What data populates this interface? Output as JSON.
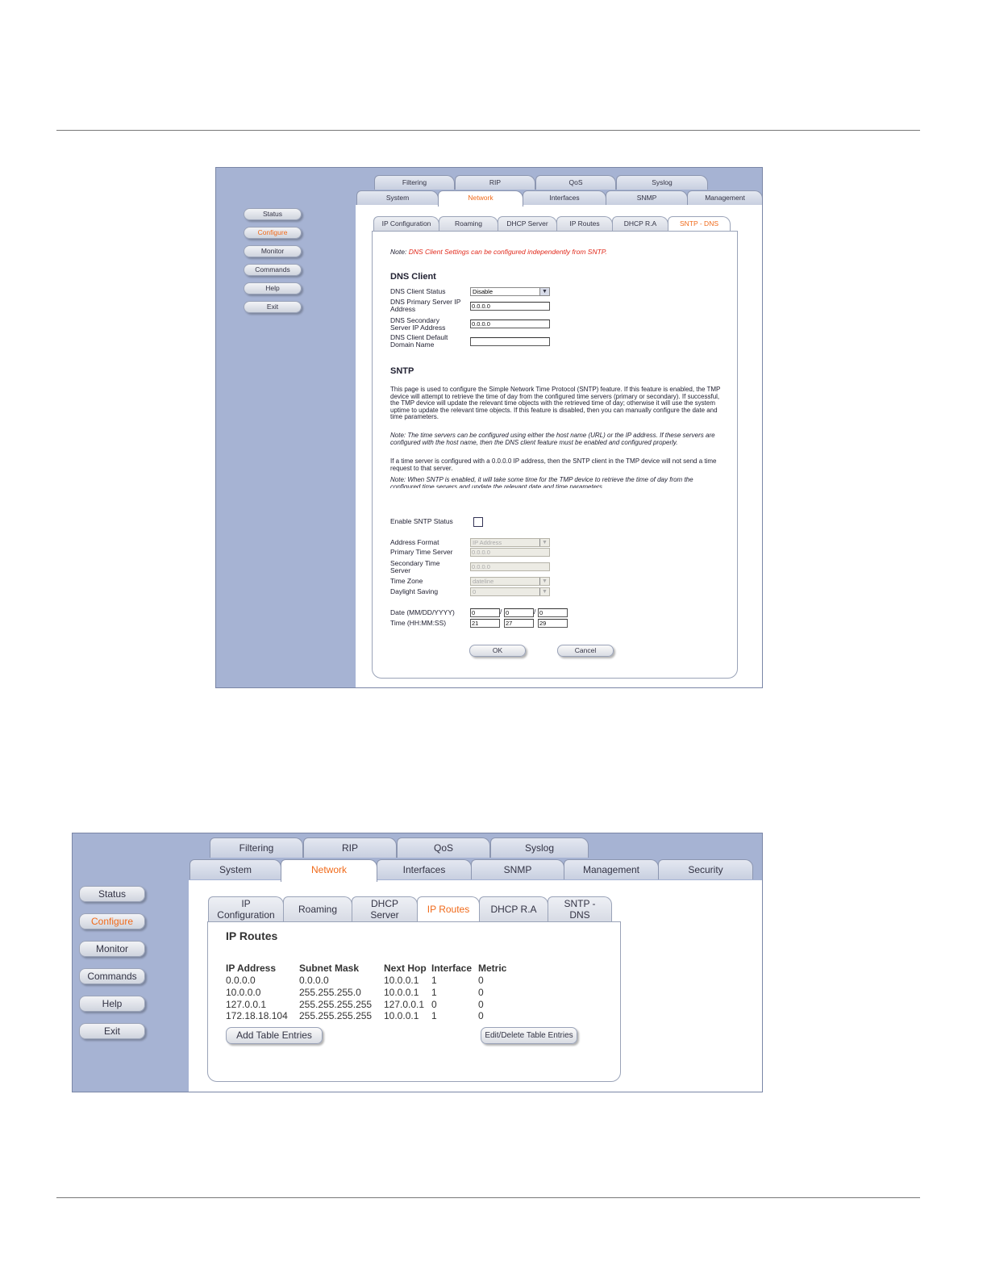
{
  "screenshot1": {
    "nav": [
      "Status",
      "Configure",
      "Monitor",
      "Commands",
      "Help",
      "Exit"
    ],
    "nav_active": "Configure",
    "tabs_row1": [
      "Filtering",
      "RIP",
      "QoS",
      "Syslog"
    ],
    "tabs_row2": [
      "System",
      "Network",
      "Interfaces",
      "SNMP",
      "Management"
    ],
    "subtabs": [
      "IP Configuration",
      "Roaming",
      "DHCP Server",
      "IP Routes",
      "DHCP R.A",
      "SNTP - DNS"
    ],
    "note_prefix": "Note:",
    "note_text": "DNS Client Settings can be configured independently from SNTP.",
    "dns_title": "DNS Client",
    "dns_status_label": "DNS Client Status",
    "dns_status_value": "Disable",
    "dns_primary_label_1": "DNS Primary Server IP",
    "dns_primary_label_2": "Address",
    "dns_primary_value": "0.0.0.0",
    "dns_secondary_label_1": "DNS Secondary",
    "dns_secondary_label_2": "Server IP Address",
    "dns_secondary_value": "0.0.0.0",
    "dns_domain_label_1": "DNS Client Default",
    "dns_domain_label_2": "Domain Name",
    "dns_domain_value": "",
    "sntp_title": "SNTP",
    "sntp_para1": "This page is used to configure the Simple Network Time Protocol (SNTP) feature. If this feature is enabled, the TMP device will attempt to retrieve the time of day from the configured time servers (primary or secondary). If successful, the TMP device will update the relevant time objects with the retrieved time of day; otherwise it will use the system uptime to update the relevant time objects. If this feature is disabled, then you can manually configure the date and time parameters.",
    "sntp_note1": "Note: The time servers can be configured using either the host name (URL) or the IP address. If these servers are configured with the host name, then the DNS client feature must be enabled and configured properly.",
    "sntp_para2": "If a time server is configured with a 0.0.0.0 IP address, then the SNTP client in the TMP device will not send a time request to that server.",
    "sntp_note2": "Note: When SNTP is enabled, it will take some time for the TMP device to retrieve the time of day from the configured time servers and update the relevant date and time parameters.",
    "enable_sntp_label": "Enable SNTP Status",
    "address_format_label": "Address Format",
    "address_format_value": "IP Address",
    "primary_time_label": "Primary Time Server",
    "primary_time_value": "0.0.0.0",
    "secondary_time_label_1": "Secondary Time",
    "secondary_time_label_2": "Server",
    "secondary_time_value": "0.0.0.0",
    "time_zone_label": "Time Zone",
    "time_zone_value": "dateline",
    "daylight_label": "Daylight Saving",
    "daylight_value": "0",
    "date_label": "Date (MM/DD/YYYY)",
    "date_values": [
      "0",
      "0",
      "0"
    ],
    "time_label": "Time (HH:MM:SS)",
    "time_values": [
      "21",
      "27",
      "29"
    ],
    "ok_label": "OK",
    "cancel_label": "Cancel"
  },
  "screenshot2": {
    "nav": [
      "Status",
      "Configure",
      "Monitor",
      "Commands",
      "Help",
      "Exit"
    ],
    "nav_active": "Configure",
    "tabs_row1": [
      "Filtering",
      "RIP",
      "QoS",
      "Syslog"
    ],
    "tabs_row2": [
      "System",
      "Network",
      "Interfaces",
      "SNMP",
      "Management",
      "Security"
    ],
    "subtabs": [
      {
        "l1": "IP",
        "l2": "Configuration"
      },
      {
        "l1": "Roaming",
        "l2": ""
      },
      {
        "l1": "DHCP",
        "l2": "Server"
      },
      {
        "l1": "IP Routes",
        "l2": ""
      },
      {
        "l1": "DHCP R.A",
        "l2": ""
      },
      {
        "l1": "SNTP -",
        "l2": "DNS"
      }
    ],
    "title": "IP Routes",
    "columns": [
      "IP Address",
      "Subnet Mask",
      "Next Hop",
      "Interface",
      "Metric"
    ],
    "rows": [
      [
        "0.0.0.0",
        "0.0.0.0",
        "10.0.0.1",
        "1",
        "0"
      ],
      [
        "10.0.0.0",
        "255.255.255.0",
        "10.0.0.1",
        "1",
        "0"
      ],
      [
        "127.0.0.1",
        "255.255.255.255",
        "127.0.0.1",
        "0",
        "0"
      ],
      [
        "172.18.18.104",
        "255.255.255.255",
        "10.0.0.1",
        "1",
        "0"
      ]
    ],
    "add_label": "Add Table Entries",
    "edit_label": "Edit/Delete Table Entries"
  }
}
